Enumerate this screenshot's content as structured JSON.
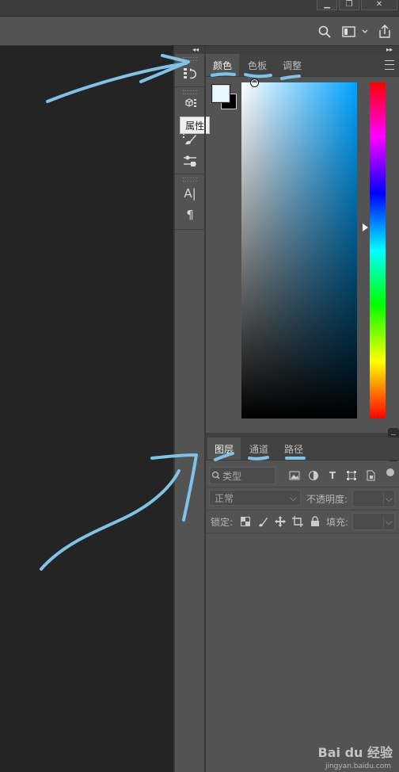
{
  "window": {
    "icon_names": [
      "minimize-icon",
      "restore-icon",
      "close-icon"
    ]
  },
  "options_bar": {
    "icon_names": [
      "search-icon",
      "workspace-icon",
      "chevron-down-icon",
      "share-icon"
    ]
  },
  "dock": {
    "collapse_arrows": "◂◂",
    "expand_arrows": "▸▸",
    "tooltip": "属性",
    "tools": [
      {
        "name": "history",
        "icon": "history-icon"
      },
      {
        "name": "properties",
        "icon": "properties-cube-icon"
      },
      {
        "name": "brush",
        "icon": "brush-icon"
      },
      {
        "name": "adjustments",
        "icon": "adjust-sliders-icon"
      },
      {
        "name": "character",
        "icon": "character-icon",
        "glyph": "A|"
      },
      {
        "name": "paragraph",
        "icon": "paragraph-icon",
        "glyph": "¶"
      }
    ]
  },
  "color_panel": {
    "tabs": [
      "颜色",
      "色板",
      "调整"
    ],
    "active_tab": "颜色",
    "foreground_color": "#e8f6ff",
    "background_color": "#000000",
    "hue_color": "#00a2ff"
  },
  "layers_panel": {
    "tabs": [
      "图层",
      "通道",
      "路径"
    ],
    "active_tab": "图层",
    "filter_placeholder": "类型",
    "blend_mode": "正常",
    "opacity_label": "不透明度:",
    "opacity_value": "",
    "lock_label": "锁定:",
    "fill_label": "填充:",
    "fill_value": ""
  },
  "annotations": {
    "stroke_color": "#7dc3ea"
  },
  "watermark": {
    "text": "Bai du 经验",
    "url": "jingyan.baidu.com"
  }
}
